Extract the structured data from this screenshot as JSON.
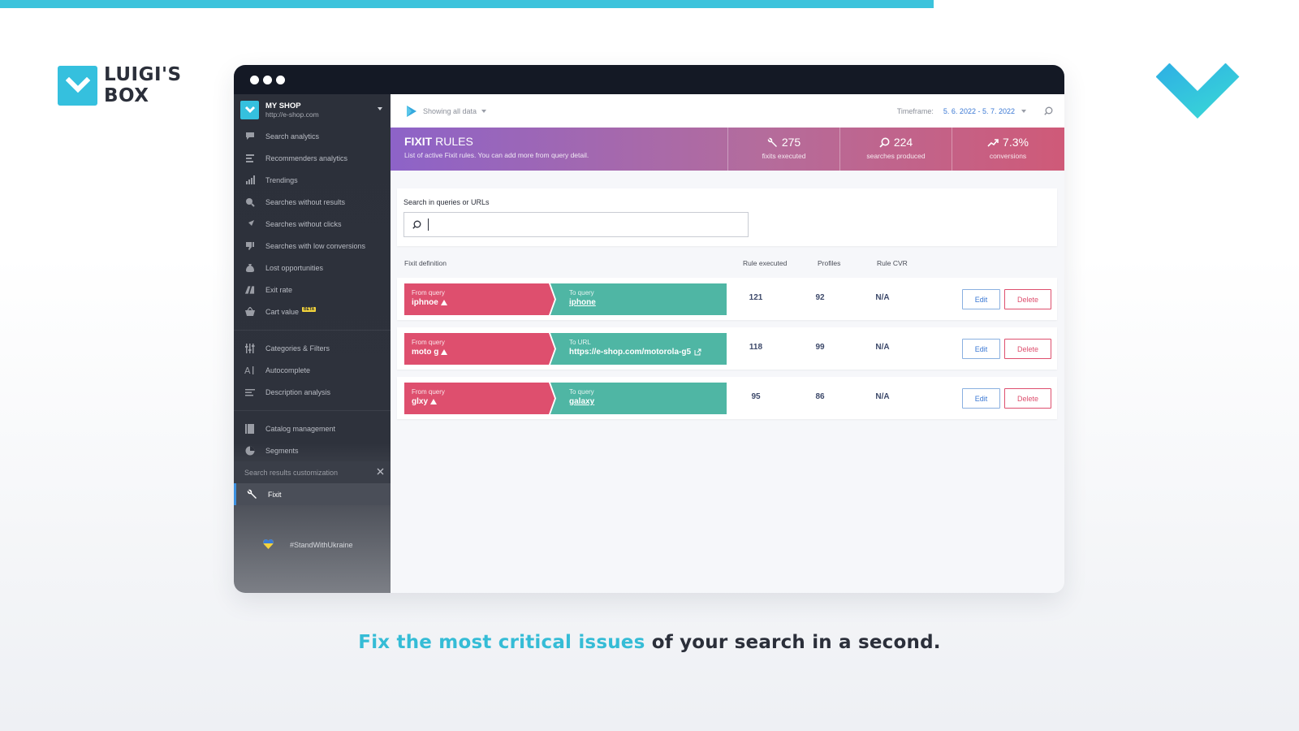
{
  "colors": {
    "accent": "#35c0de",
    "from_rule": "#de4f6e",
    "to_rule": "#4fb6a4",
    "link": "#3a78d4"
  },
  "brand": {
    "line1": "LUIGI'S",
    "line2": "BOX"
  },
  "shop": {
    "name": "MY SHOP",
    "url": "http://e-shop.com"
  },
  "sidebar": {
    "items": [
      {
        "label": "Search analytics",
        "icon": "chat-bubble-icon"
      },
      {
        "label": "Recommenders analytics",
        "icon": "list-icon"
      },
      {
        "label": "Trendings",
        "icon": "bar-chart-icon"
      },
      {
        "label": "Searches without results",
        "icon": "search-x-icon"
      },
      {
        "label": "Searches without clicks",
        "icon": "cursor-icon"
      },
      {
        "label": "Searches with low conversions",
        "icon": "thumbs-down-icon"
      },
      {
        "label": "Lost opportunities",
        "icon": "money-bag-icon"
      },
      {
        "label": "Exit rate",
        "icon": "exit-icon"
      },
      {
        "label": "Cart value",
        "icon": "basket-icon",
        "badge": "BETA"
      }
    ],
    "items2": [
      {
        "label": "Categories & Filters",
        "icon": "sliders-icon"
      },
      {
        "label": "Autocomplete",
        "icon": "autocomplete-icon"
      },
      {
        "label": "Description analysis",
        "icon": "text-lines-icon"
      }
    ],
    "items3": [
      {
        "label": "Catalog management",
        "icon": "book-icon"
      },
      {
        "label": "Segments",
        "icon": "pie-icon"
      }
    ],
    "section_title": "Search results customization",
    "active_item": {
      "label": "Fixit",
      "icon": "wrench-icon"
    },
    "footer": "#StandWithUkraine"
  },
  "topbar": {
    "showing": "Showing all data",
    "timeframe_label": "Timeframe:",
    "timeframe_value": "5. 6. 2022 - 5. 7. 2022"
  },
  "banner": {
    "title_bold": "FIXIT",
    "title_rest": " RULES",
    "subtitle": "List of active Fixit rules. You can add more from query detail.",
    "stats": [
      {
        "value": "275",
        "label": "fixits executed",
        "icon": "wrench-icon"
      },
      {
        "value": "224",
        "label": "searches produced",
        "icon": "search-icon"
      },
      {
        "value": "7.3%",
        "label": "conversions",
        "icon": "trend-up-icon"
      }
    ]
  },
  "search": {
    "label": "Search in queries or URLs",
    "value": "",
    "placeholder": ""
  },
  "table": {
    "headers": {
      "definition": "Fixit definition",
      "executed": "Rule executed",
      "profiles": "Profiles",
      "cvr": "Rule CVR"
    },
    "edit_label": "Edit",
    "delete_label": "Delete",
    "rows": [
      {
        "from_label": "From query",
        "from_value": "iphnoe",
        "to_label": "To query",
        "to_value": "iphone",
        "executed": "121",
        "profiles": "92",
        "cvr": "N/A"
      },
      {
        "from_label": "From query",
        "from_value": "moto g",
        "to_label": "To URL",
        "to_value": "https://e-shop.com/motorola-g5",
        "executed": "118",
        "profiles": "99",
        "cvr": "N/A"
      },
      {
        "from_label": "From query",
        "from_value": "glxy",
        "to_label": "To query",
        "to_value": "galaxy",
        "executed": "95",
        "profiles": "86",
        "cvr": "N/A"
      }
    ]
  },
  "tagline": {
    "highlight": "Fix the most critical issues",
    "rest": " of your search in a second."
  }
}
